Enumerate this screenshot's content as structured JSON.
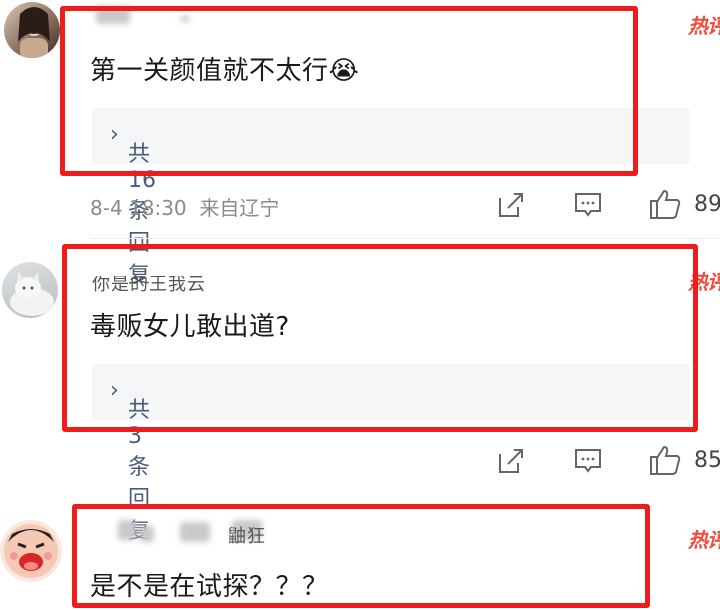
{
  "hot_badge": "热评",
  "comments": [
    {
      "text": "第一关颜值就不太行😭",
      "replies": "共16条回复",
      "chevron": "›",
      "time": "8-4 18:30",
      "location": "来自辽宁",
      "likes": "89"
    },
    {
      "username": "你是的王我云",
      "text": "毒贩女儿敢出道?",
      "replies": "共3条回复",
      "chevron": "›",
      "likes": "85"
    },
    {
      "username_fragment": "鼬狂",
      "text": "是不是在试探？？？"
    }
  ],
  "colors": {
    "highlight": "#ee1c1c",
    "hot": "#f24b3b",
    "link": "#4a5a78"
  }
}
